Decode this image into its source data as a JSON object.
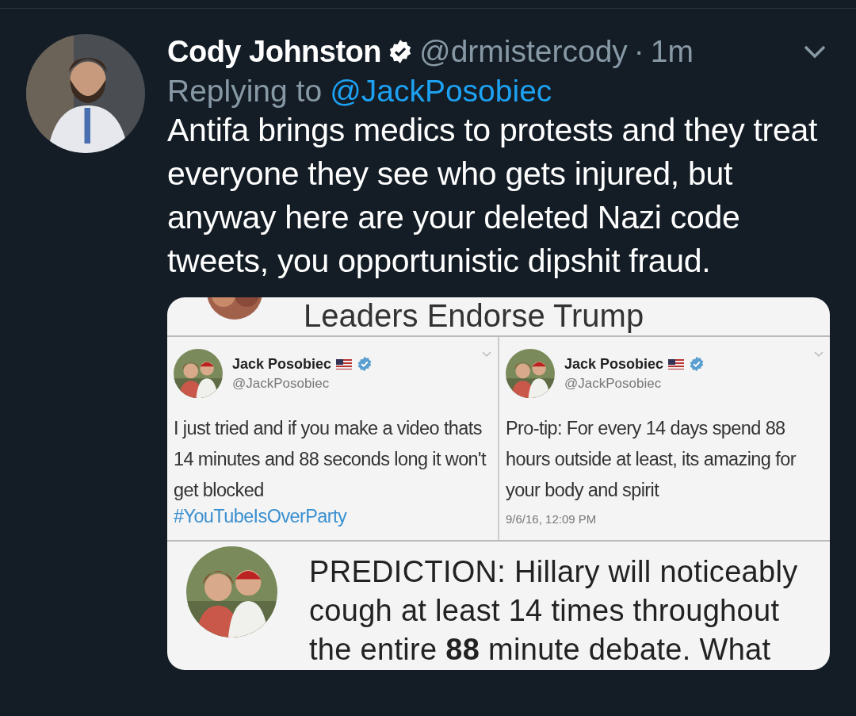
{
  "tweet": {
    "author": {
      "name": "Cody Johnston",
      "verified": true,
      "handle": "@drmistercody",
      "separator": "·",
      "time": "1m"
    },
    "reply": {
      "prefix": "Replying to",
      "handle": "@JackPosobiec"
    },
    "text": "Antifa brings medics to protests and they treat everyone they see who gets injured, but anyway here are your deleted Nazi code tweets, you opportunistic dipshit fraud.",
    "media": {
      "header": "Leaders Endorse Trump",
      "tweets": [
        {
          "name": "Jack Posobiec",
          "handle": "@JackPosobiec",
          "verified": true,
          "text": "I just tried and if you make a video thats 14 minutes and 88 seconds long it won't get blocked",
          "hashtag": "#YouTubeIsOverParty"
        },
        {
          "name": "Jack Posobiec",
          "handle": "@JackPosobiec",
          "verified": true,
          "text": "Pro-tip: For every 14 days spend 88 hours outside at least, its amazing for your body and spirit",
          "timestamp": "9/6/16, 12:09 PM"
        }
      ],
      "bottom_tweet": {
        "text": "PREDICTION: Hillary will noticeably cough at least 14 times throughout the entire **88** minute debate. What"
      }
    }
  }
}
